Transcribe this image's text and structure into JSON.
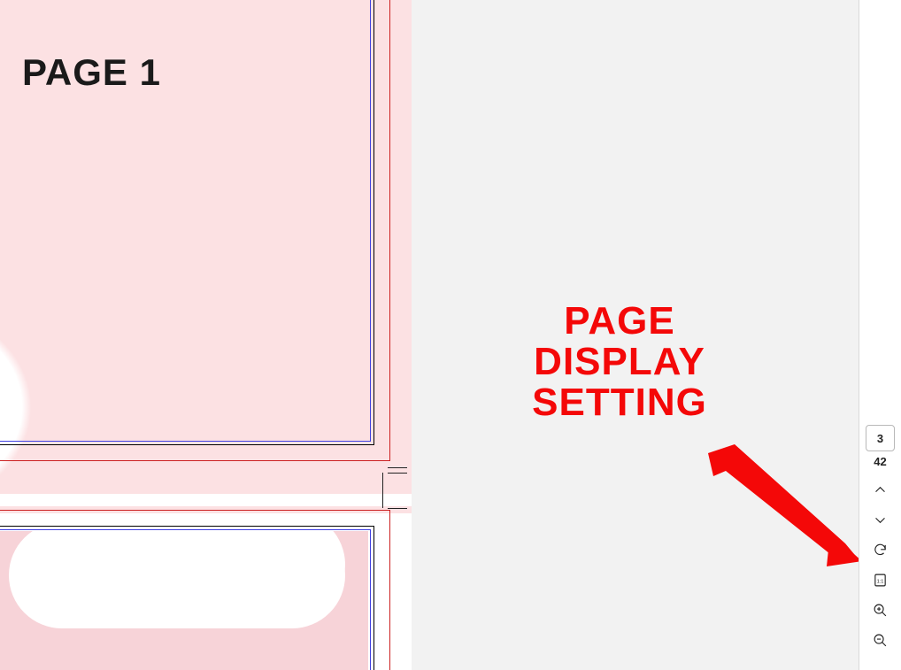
{
  "page1": {
    "title": "PAGE 1"
  },
  "annotation": {
    "line1": "PAGE",
    "line2": "DISPLAY",
    "line3": "SETTING"
  },
  "sidebar": {
    "current_page": "3",
    "total_pages": "42",
    "icons": {
      "page_up": "chevron-up-icon",
      "page_down": "chevron-down-icon",
      "rotate": "rotate-icon",
      "page_display": "page-display-icon",
      "zoom_in": "zoom-in-icon",
      "zoom_out": "zoom-out-icon"
    }
  }
}
